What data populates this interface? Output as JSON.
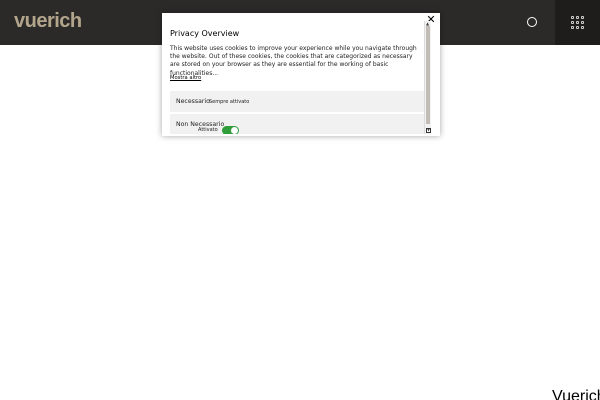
{
  "header": {
    "logo": "vuerich",
    "search_icon": "search-icon",
    "menu_icon": "grid-menu-icon"
  },
  "modal": {
    "close_label": "✕",
    "title": "Privacy Overview",
    "description": "This website uses cookies to improve your experience while you navigate through the website. Out of these cookies, the cookies that are categorized as necessary are stored on your browser as they are essential for the working of basic functionalities...",
    "show_more": "Mostra altro",
    "categories": [
      {
        "name": "Necessario",
        "status": "Sempre attivato"
      },
      {
        "name": "Non Necessario",
        "toggle_label": "Attivato",
        "enabled": true
      }
    ]
  },
  "footer_text": "Vuerich",
  "colors": {
    "header_bg": "#2b2a29",
    "logo": "#b3a58c",
    "toggle_on": "#2e9d3a"
  }
}
